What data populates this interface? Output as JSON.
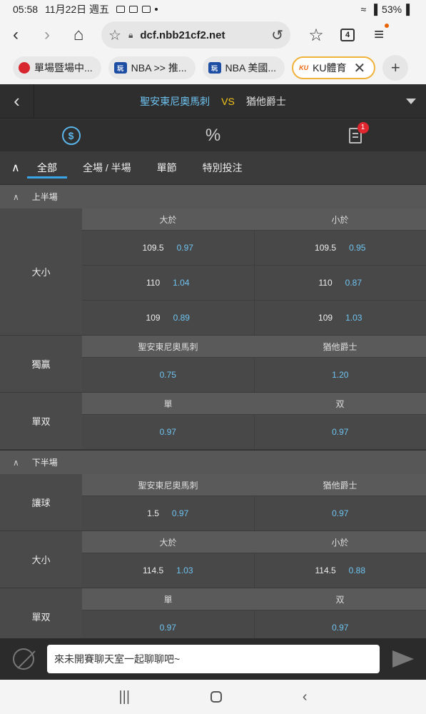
{
  "status_bar": {
    "time": "05:58",
    "date": "11月22日 週五",
    "battery": "53%"
  },
  "browser": {
    "url": "dcf.nbb21cf2.net",
    "tab_count": "4",
    "tabs": [
      {
        "label": "單場暨場中...",
        "icon": "red-badge-icon"
      },
      {
        "label": "NBA >> 推...",
        "icon": "blue-logo-icon"
      },
      {
        "label": "NBA 美國...",
        "icon": "blue-logo-icon"
      },
      {
        "label": "KU體育",
        "icon": "ku-logo-icon"
      }
    ]
  },
  "match": {
    "home": "聖安東尼奧馬刺",
    "vs": "VS",
    "away": "猶他爵士"
  },
  "icon_row": {
    "badge_count": "1",
    "percent_symbol": "%"
  },
  "bet_tabs": [
    "全部",
    "全場 / 半場",
    "單節",
    "特別投注"
  ],
  "sections": [
    {
      "title": "上半場",
      "markets": [
        {
          "label": "大小",
          "headers": [
            "大於",
            "小於"
          ],
          "rows": [
            [
              {
                "line": "109.5",
                "odds": "0.97"
              },
              {
                "line": "109.5",
                "odds": "0.95"
              }
            ],
            [
              {
                "line": "110",
                "odds": "1.04"
              },
              {
                "line": "110",
                "odds": "0.87"
              }
            ],
            [
              {
                "line": "109",
                "odds": "0.89"
              },
              {
                "line": "109",
                "odds": "1.03"
              }
            ]
          ]
        },
        {
          "label": "獨贏",
          "headers": [
            "聖安東尼奧馬刺",
            "猶他爵士"
          ],
          "rows": [
            [
              {
                "line": "",
                "odds": "0.75"
              },
              {
                "line": "",
                "odds": "1.20"
              }
            ]
          ]
        },
        {
          "label": "單双",
          "headers": [
            "單",
            "双"
          ],
          "rows": [
            [
              {
                "line": "",
                "odds": "0.97"
              },
              {
                "line": "",
                "odds": "0.97"
              }
            ]
          ]
        }
      ]
    },
    {
      "title": "下半場",
      "markets": [
        {
          "label": "讓球",
          "headers": [
            "聖安東尼奧馬刺",
            "猶他爵士"
          ],
          "rows": [
            [
              {
                "line": "1.5",
                "odds": "0.97"
              },
              {
                "line": "",
                "odds": "0.97"
              }
            ]
          ]
        },
        {
          "label": "大小",
          "headers": [
            "大於",
            "小於"
          ],
          "rows": [
            [
              {
                "line": "114.5",
                "odds": "1.03"
              },
              {
                "line": "114.5",
                "odds": "0.88"
              }
            ]
          ]
        },
        {
          "label": "單双",
          "headers": [
            "單",
            "双"
          ],
          "rows": [
            [
              {
                "line": "",
                "odds": "0.97"
              },
              {
                "line": "",
                "odds": "0.97"
              }
            ]
          ]
        }
      ]
    }
  ],
  "chat": {
    "placeholder": "來未開賽聊天室一起聊聊吧~"
  },
  "colors": {
    "accent_blue": "#6ec3f0",
    "vs_yellow": "#f5c518",
    "badge_red": "#e0262f"
  }
}
